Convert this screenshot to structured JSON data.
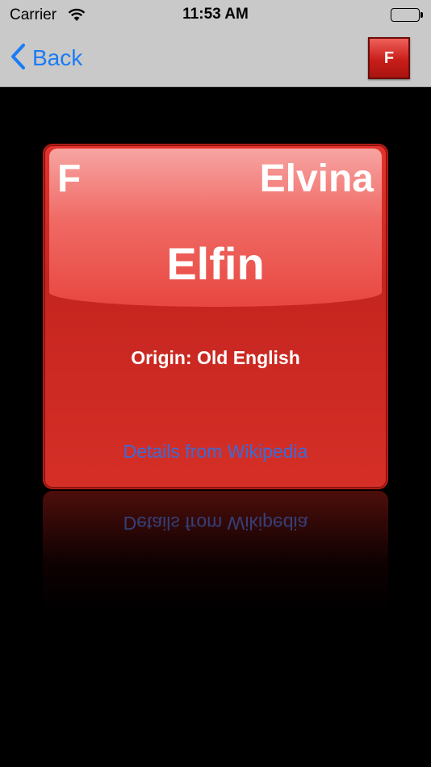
{
  "status_bar": {
    "carrier": "Carrier",
    "time": "11:53 AM"
  },
  "nav": {
    "back_label": "Back",
    "badge_letter": "F"
  },
  "card": {
    "symbol": "F",
    "name": "Elvina",
    "meaning": "Elfin",
    "origin": "Origin: Old English",
    "link": "Details from Wikipedia"
  },
  "colors": {
    "accent_blue": "#1a7cf5",
    "card_red": "#d52f27",
    "link_blue": "#3a6bd6"
  }
}
